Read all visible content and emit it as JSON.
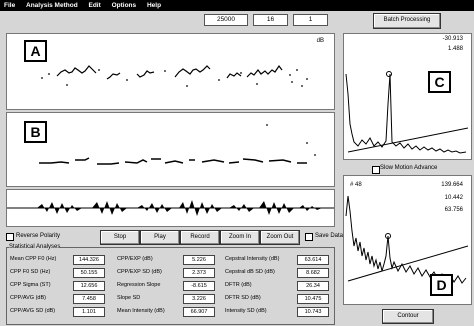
{
  "menu": [
    "File",
    "Analysis Method",
    "Edit",
    "Options",
    "Help"
  ],
  "top_fields": [
    "25000",
    "16",
    "1"
  ],
  "batch_button": "Batch Processing",
  "panel_a": {
    "letter": "A",
    "unit": "dB"
  },
  "panel_b": {
    "letter": "B"
  },
  "panel_c": {
    "letter": "C",
    "val1": "-30.913",
    "val2": "1.488"
  },
  "panel_d": {
    "letter": "D",
    "frame": "# 48",
    "val1": "139.664",
    "val2": "10.442",
    "val3": "63.756"
  },
  "slow_motion": "Slow Motion Advance",
  "reverse_polarity": "Reverse Polarity",
  "controls": {
    "stop": "Stop",
    "play": "Play",
    "record": "Record",
    "zoom_in": "Zoom In",
    "zoom_out": "Zoom Out",
    "save_data": "Save Data"
  },
  "contour": "Contour",
  "stats": {
    "title": "Statistical Analyses",
    "col1": [
      {
        "label": "Mean CPP F0 (Hz)",
        "value": "144.326"
      },
      {
        "label": "CPP F0 SD (Hz)",
        "value": "50.155"
      },
      {
        "label": "CPP Sigma (ST)",
        "value": "12.656"
      },
      {
        "label": "CPP/AVG (dB)",
        "value": "7.458"
      },
      {
        "label": "CPP/AVG SD (dB)",
        "value": "1.101"
      }
    ],
    "col2": [
      {
        "label": "CPP/EXP (dB)",
        "value": "5.226"
      },
      {
        "label": "CPP/EXP SD (dB)",
        "value": "2.373"
      },
      {
        "label": "Regression Slope",
        "value": "-8.615"
      },
      {
        "label": "Slope SD",
        "value": "3.226"
      },
      {
        "label": "Mean Intensity (dB)",
        "value": "66.907"
      }
    ],
    "col3": [
      {
        "label": "Cepstral Intensity (dB)",
        "value": "63.614"
      },
      {
        "label": "Cepstral dB SD (dB)",
        "value": "8.682"
      },
      {
        "label": "DFTR (dB)",
        "value": "26.34"
      },
      {
        "label": "DFTR SD (dB)",
        "value": "10.475"
      },
      {
        "label": "Intensity SD (dB)",
        "value": "10.743"
      }
    ]
  }
}
